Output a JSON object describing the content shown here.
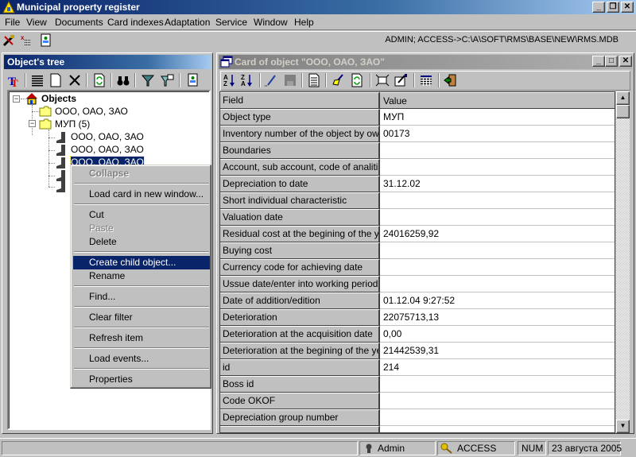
{
  "app": {
    "title": "Municipal property register",
    "window_buttons": {
      "minimize": "_",
      "restore": "❐",
      "close": "✕"
    }
  },
  "menubar": [
    {
      "label": "File"
    },
    {
      "label": "View"
    },
    {
      "label": "Documents"
    },
    {
      "label": "Card indexes"
    },
    {
      "label": "Adaptation"
    },
    {
      "label": "Service"
    },
    {
      "label": "Window"
    },
    {
      "label": "Help"
    }
  ],
  "main_toolbar": {
    "icons": [
      "tools-icon",
      "delete-grid-icon",
      "user-card-icon"
    ],
    "connection_path": "ADMIN; ACCESS->C:\\A\\SOFT\\RMS\\BASE\\NEW\\RMS.MDB"
  },
  "tree_panel": {
    "title": "Object's tree",
    "toolbar_icons": [
      "font-icon",
      "list-icon",
      "new-document-icon",
      "delete-icon",
      "refresh-icon",
      "find-binoculars-icon",
      "filter-icon",
      "filter-edit-icon",
      "user-card-icon"
    ],
    "root": {
      "label": "Objects",
      "icon": "house-icon",
      "expanded": true
    },
    "nodes": [
      {
        "label": "ООО, ОАО, ЗАО",
        "icon": "folder-icon",
        "level": 1
      },
      {
        "label": "МУП (5)",
        "icon": "folder-icon",
        "level": 1,
        "expanded": true
      },
      {
        "label": "ООО, ОАО, ЗАО",
        "icon": "boot-icon",
        "level": 2
      },
      {
        "label": "ООО, ОАО, ЗАО",
        "icon": "boot-icon",
        "level": 2
      },
      {
        "label": "ООО, ОАО, ЗАО",
        "icon": "boot-icon",
        "level": 2,
        "selected": true
      },
      {
        "label": "",
        "icon": "boot-icon",
        "level": 2
      },
      {
        "label": "",
        "icon": "boot-icon",
        "level": 2
      }
    ]
  },
  "context_menu": {
    "items": [
      {
        "label": "Collapse",
        "disabled": true,
        "bold": true
      },
      {
        "separator": true
      },
      {
        "label": "Load card in new window..."
      },
      {
        "separator": true
      },
      {
        "label": "Cut"
      },
      {
        "label": "Paste",
        "disabled": true
      },
      {
        "label": "Delete"
      },
      {
        "separator": true
      },
      {
        "label": "Create child object...",
        "highlighted": true
      },
      {
        "label": "Rename"
      },
      {
        "separator": true
      },
      {
        "label": "Find..."
      },
      {
        "separator": true
      },
      {
        "label": "Clear filter"
      },
      {
        "separator": true
      },
      {
        "label": "Refresh item"
      },
      {
        "separator": true
      },
      {
        "label": "Load events..."
      },
      {
        "separator": true
      },
      {
        "label": "Properties"
      }
    ]
  },
  "card_panel": {
    "title": "Card of object \"ООО, ОАО, ЗАО\"",
    "window_buttons": {
      "minimize": "_",
      "maximize": "□",
      "close": "✕"
    },
    "toolbar_icons": [
      "sort-az-icon",
      "sort-za-icon",
      "edit-pencil-icon",
      "save-disk-icon",
      "document-icon",
      "clear-brush-icon",
      "refresh-icon",
      "fit-icon",
      "properties-icon",
      "grid-icon",
      "exit-door-icon"
    ],
    "columns": {
      "field": "Field",
      "value": "Value"
    },
    "rows": [
      {
        "field": "Object type",
        "value": "МУП"
      },
      {
        "field": "Inventory number of the object by owner",
        "value": "00173"
      },
      {
        "field": "Boundaries",
        "value": ""
      },
      {
        "field": "Account, sub account, code of analitical",
        "value": ""
      },
      {
        "field": "Depreciation to date",
        "value": "31.12.02"
      },
      {
        "field": "Short individual characteristic",
        "value": ""
      },
      {
        "field": "Valuation date",
        "value": ""
      },
      {
        "field": "Residual cost at the begining of the year",
        "value": "24016259,92"
      },
      {
        "field": "Buying cost",
        "value": ""
      },
      {
        "field": "Currency code for achieving date",
        "value": ""
      },
      {
        "field": "Ussue date/enter into working period",
        "value": ""
      },
      {
        "field": "Date of addition/edition",
        "value": "01.12.04 9:27:52"
      },
      {
        "field": "Deterioration",
        "value": "22075713,13"
      },
      {
        "field": "Deterioration at the acquisition date",
        "value": "0,00"
      },
      {
        "field": "Deterioration at the begining of the year",
        "value": "21442539,31"
      },
      {
        "field": "id",
        "value": "214"
      },
      {
        "field": "Boss id",
        "value": ""
      },
      {
        "field": "Code OKOF",
        "value": ""
      },
      {
        "field": "Depreciation group number",
        "value": ""
      },
      {
        "field": "",
        "value": ""
      }
    ]
  },
  "statusbar": {
    "user": "Admin",
    "db": "ACCESS",
    "numlock": "NUM",
    "date": "23 августа 2005"
  }
}
